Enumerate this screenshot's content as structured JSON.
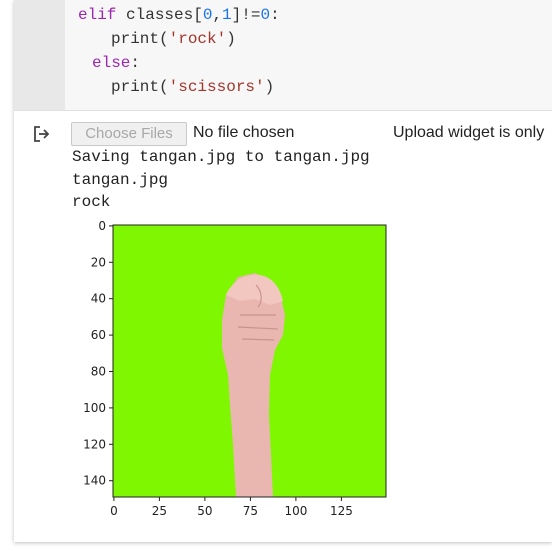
{
  "code": {
    "line1": {
      "keyword": "elif",
      "expr_pre": " classes[",
      "idx0": "0",
      "comma": ",",
      "idx1": "1",
      "expr_mid": "]!=",
      "zero": "0",
      "colon": ":"
    },
    "line2": {
      "func": "print(",
      "str": "'rock'",
      "close": ")"
    },
    "line3": {
      "keyword": "else",
      "colon": ":"
    },
    "line4": {
      "func": "print(",
      "str": "'scissors'",
      "close": ")"
    }
  },
  "upload": {
    "button_label": "Choose Files",
    "status": "No file chosen",
    "note": "Upload widget is only"
  },
  "output": {
    "saving": "Saving tangan.jpg to tangan.jpg",
    "filename": "tangan.jpg",
    "prediction": "rock"
  },
  "image_plot": {
    "image_description_color": "#7ff700",
    "x_ticks": [
      "0",
      "25",
      "50",
      "75",
      "100",
      "125"
    ],
    "y_ticks": [
      "0",
      "20",
      "40",
      "60",
      "80",
      "100",
      "120",
      "140"
    ]
  }
}
